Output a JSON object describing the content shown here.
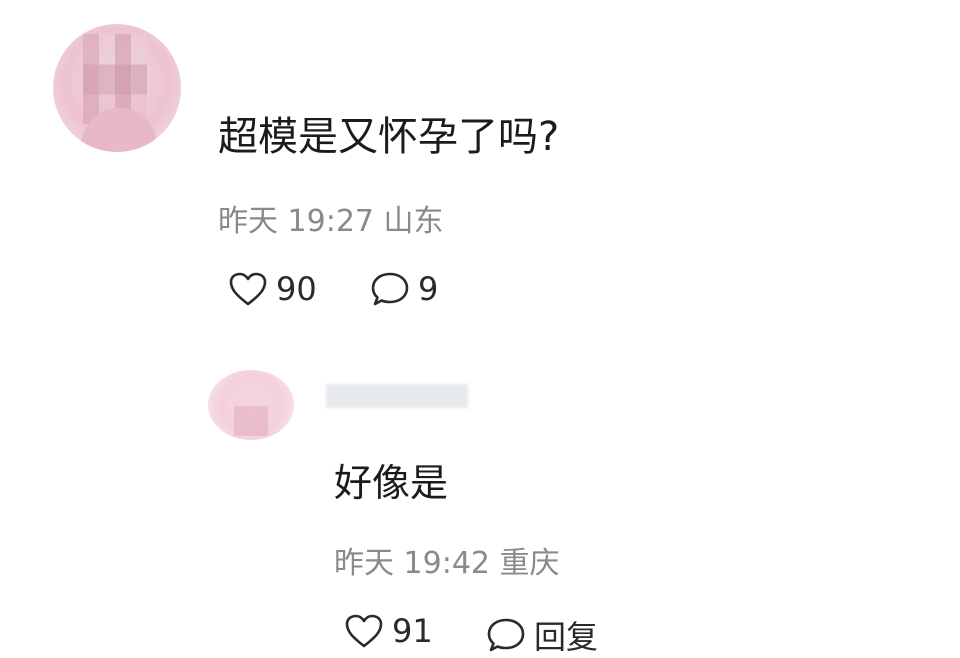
{
  "main_comment": {
    "text": "超模是又怀孕了吗?",
    "meta": "昨天 19:27 山东",
    "likes": "90",
    "comments": "9"
  },
  "reply_comment": {
    "text": "好像是",
    "meta": "昨天 19:42 重庆",
    "likes": "91",
    "reply_label": "回复"
  },
  "icons": {
    "like": "heart-outline-icon",
    "comment": "speech-bubble-icon"
  },
  "colors": {
    "meta_text": "#8a8a8a",
    "body_text": "#1b1b1b"
  }
}
